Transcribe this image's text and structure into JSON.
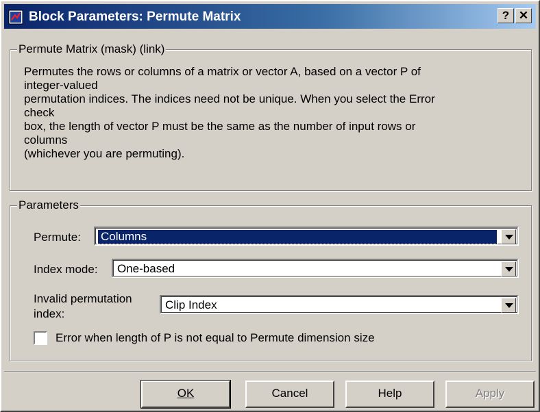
{
  "window": {
    "title": "Block Parameters: Permute Matrix",
    "help_glyph": "?",
    "close_glyph": "✕"
  },
  "description": {
    "legend": "Permute Matrix (mask) (link)",
    "lines": [
      "Permutes the rows or columns of a matrix or vector A, based on a vector P of",
      "integer-valued",
      " permutation indices.  The indices need not be unique. When you select the Error",
      "check",
      " box, the length of vector P must be the same as the number of input rows or",
      "columns",
      " (whichever you are permuting)."
    ]
  },
  "parameters": {
    "legend": "Parameters",
    "permute": {
      "label": "Permute:",
      "value": "Columns"
    },
    "index_mode": {
      "label": "Index mode:",
      "value": "One-based"
    },
    "invalid_index": {
      "label_line1": "Invalid permutation",
      "label_line2": "index:",
      "value": "Clip Index"
    },
    "error_check": {
      "label": "Error when length of P is not equal to Permute dimension size",
      "checked": false
    }
  },
  "buttons": {
    "ok": "OK",
    "cancel": "Cancel",
    "help": "Help",
    "apply": "Apply"
  }
}
